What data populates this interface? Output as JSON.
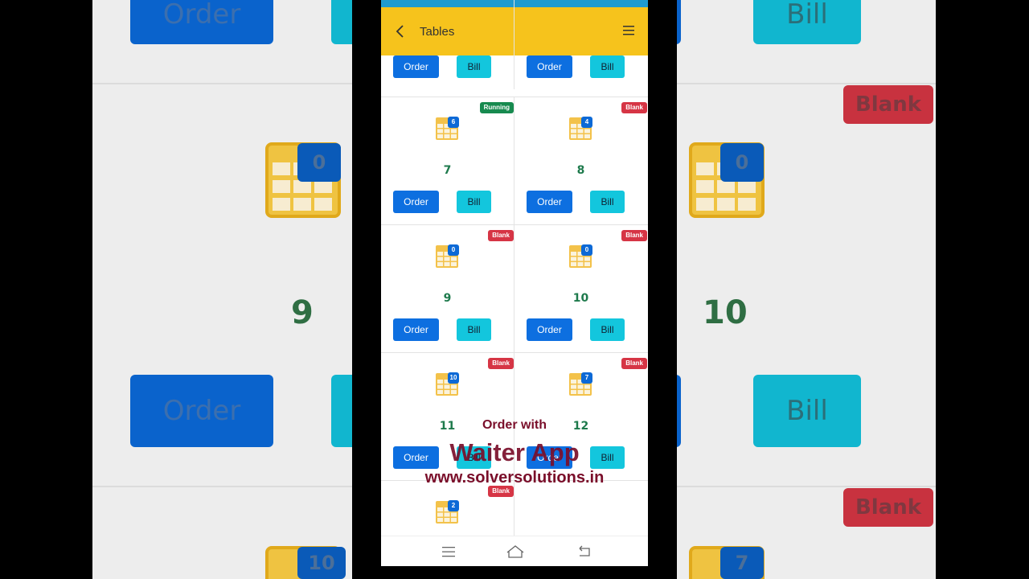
{
  "app": {
    "title": "Tables",
    "nav_icons": [
      "back-icon",
      "hamburger-menu-icon"
    ]
  },
  "top_row": [
    {
      "order_label": "Order",
      "bill_label": "Bill"
    },
    {
      "order_label": "Order",
      "bill_label": "Bill"
    }
  ],
  "tables": [
    {
      "number": "7",
      "status": "Running",
      "guests": "6",
      "order_label": "Order",
      "bill_label": "Bill"
    },
    {
      "number": "8",
      "status": "Blank",
      "guests": "4",
      "order_label": "Order",
      "bill_label": "Bill"
    },
    {
      "number": "9",
      "status": "Blank",
      "guests": "0",
      "order_label": "Order",
      "bill_label": "Bill"
    },
    {
      "number": "10",
      "status": "Blank",
      "guests": "0",
      "order_label": "Order",
      "bill_label": "Bill"
    },
    {
      "number": "11",
      "status": "Blank",
      "guests": "10",
      "order_label": "Order",
      "bill_label": "Bill"
    },
    {
      "number": "12",
      "status": "Blank",
      "guests": "7",
      "order_label": "Order",
      "bill_label": "Bill"
    },
    {
      "number": "",
      "status": "Blank",
      "guests": "2",
      "order_label": "",
      "bill_label": ""
    }
  ],
  "background": {
    "left": {
      "order_label": "Order",
      "number": "9",
      "guests_top": "0",
      "guests_bottom": "10"
    },
    "right": {
      "bill_top": "Bill",
      "bill_bottom": "Bill",
      "number": "10",
      "badge_top": "Blank",
      "badge_bottom": "Blank",
      "guests_top": "0",
      "guests_bottom": "7"
    }
  },
  "watermark": {
    "line1": "Order with",
    "line2": "Waiter App",
    "line3": "www.solversolutions.in"
  },
  "colors": {
    "appbar": "#f6c31c",
    "statusbar": "#1f9bd0",
    "order_button": "#0d6fe0",
    "bill_button": "#13c6dd",
    "running_badge": "#178a4f",
    "blank_badge": "#d63545",
    "table_number": "#1e7a4c",
    "watermark": "#7a0e2a"
  },
  "system_nav_icons": [
    "recent-apps-icon",
    "home-icon",
    "back-nav-icon"
  ]
}
